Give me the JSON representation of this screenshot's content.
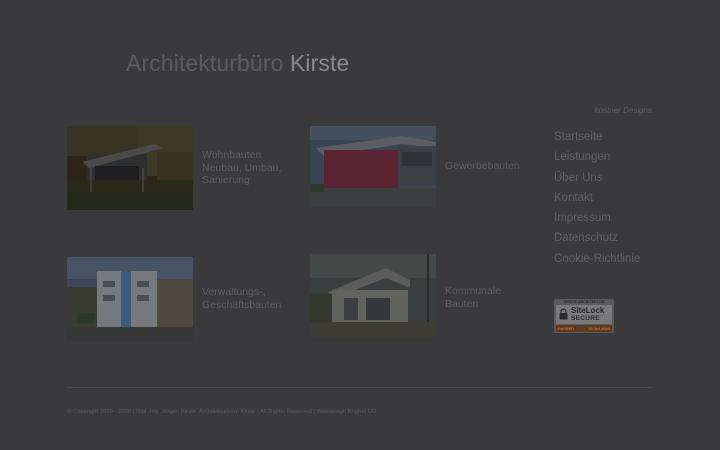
{
  "header": {
    "title_part1": "Architekturbüro",
    "title_part2": "Kirste",
    "tagline": "kostner Designs"
  },
  "tiles": [
    {
      "label_lines": [
        "Wohnbauten",
        "Neubau, Umbau,",
        "Sanierung"
      ]
    },
    {
      "label_lines": [
        "Gewerbebauten"
      ]
    },
    {
      "label_lines": [
        "Verwaltungs-,",
        "Geschäftsbauten"
      ]
    },
    {
      "label_lines": [
        "Kommunale",
        "Bauten"
      ]
    }
  ],
  "nav": {
    "items": [
      {
        "label": "Startseite"
      },
      {
        "label": "Leistungen"
      },
      {
        "label": "Über Uns"
      },
      {
        "label": "Kontakt"
      },
      {
        "label": "Impressum"
      },
      {
        "label": "Datenschutz"
      },
      {
        "label": "Cookie-Richtlinie"
      }
    ]
  },
  "badge": {
    "domain": "KIRSTE-ARCHITEKT.DE",
    "name": "SiteLock",
    "status": "SECURE",
    "passed": "PASSED",
    "date": "29-Jul-2025",
    "icon": "padlock-icon"
  },
  "footer": {
    "copyright": "© Copyright 2020 - 2026 | Dipl.-Ing. Jürgen Kirste, Architekturbüro Kirste | All Rights Reserved | Webdesign Bogbet UG"
  },
  "colors": {
    "overlay_background": "#3a3a3c",
    "badge_accent": "#c8763a"
  }
}
